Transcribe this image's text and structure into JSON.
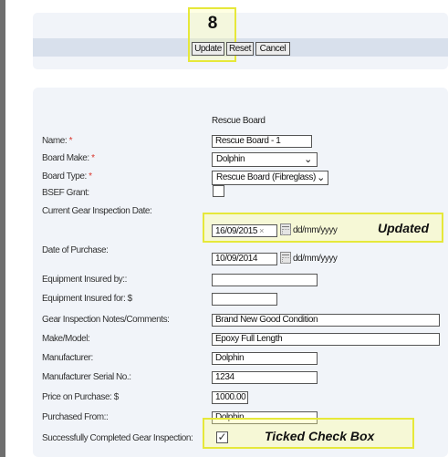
{
  "toolbar": {
    "step_number": "8",
    "update_label": "Update",
    "reset_label": "Reset",
    "cancel_label": "Cancel"
  },
  "form": {
    "section_title": "Rescue Board",
    "required_mark": "*",
    "date_format_hint": "dd/mm/yyyy",
    "clear_icon": "×",
    "fields": {
      "name": {
        "label": "Name:",
        "value": "Rescue Board - 1"
      },
      "board_make": {
        "label": "Board Make:",
        "value": "Dolphin"
      },
      "board_type": {
        "label": "Board Type:",
        "value": "Rescue Board (Fibreglass)"
      },
      "bsef_grant": {
        "label": "BSEF Grant:"
      },
      "inspection_date": {
        "label": "Current Gear Inspection Date:",
        "value": "16/09/2015"
      },
      "purchase_date": {
        "label": "Date of Purchase:",
        "value": "10/09/2014"
      },
      "insured_by": {
        "label": "Equipment Insured by::",
        "value": ""
      },
      "insured_for": {
        "label": "Equipment Insured for:  $",
        "value": ""
      },
      "notes": {
        "label": "Gear Inspection Notes/Comments:",
        "value": "Brand New Good Condition"
      },
      "make_model": {
        "label": "Make/Model:",
        "value": "Epoxy Full Length"
      },
      "manufacturer": {
        "label": "Manufacturer:",
        "value": "Dolphin"
      },
      "serial": {
        "label": "Manufacturer Serial No.:",
        "value": "1234"
      },
      "price": {
        "label": "Price on Purchase:  $",
        "value": "1000.00"
      },
      "purchased_from": {
        "label": "Purchased From::",
        "value": "Dolphin"
      },
      "completed_inspection": {
        "label": "Successfully Completed Gear Inspection:",
        "checked": true
      }
    }
  },
  "annotations": {
    "updated": "Updated",
    "ticked": "Ticked Check Box"
  },
  "icons": {
    "calendar": "calendar-icon",
    "dropdown": "chevron-down-icon",
    "check": "check-icon"
  },
  "colors": {
    "highlight_border": "#e6e83a",
    "required": "#d9342b",
    "panel_bg": "#f1f4f9"
  }
}
